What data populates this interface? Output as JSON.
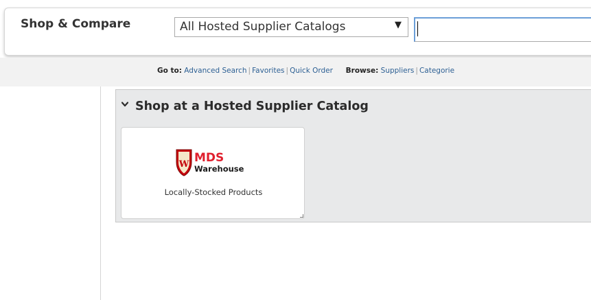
{
  "search_bar": {
    "title": "Shop & Compare",
    "catalog_select": {
      "selected": "All Hosted Supplier Catalogs",
      "caret_icon": "triangle-down-icon"
    },
    "search_input": {
      "value": "",
      "placeholder": ""
    }
  },
  "nav": {
    "goto_label": "Go to:",
    "goto_links": [
      "Advanced Search",
      "Favorites",
      "Quick Order"
    ],
    "browse_label": "Browse:",
    "browse_links": [
      "Suppliers",
      "Categorie"
    ],
    "link_color": "#2c5f93"
  },
  "hosted_section": {
    "header": "Shop at a Hosted Supplier Catalog",
    "header_icon": "chevron-down-icon",
    "panel_color": "#e8e9ea",
    "tiles": [
      {
        "logo_icon": "uw-crest-icon",
        "logo_title": "MDS",
        "logo_subtitle": "Warehouse",
        "logo_title_color": "#e0202e",
        "caption": "Locally-Stocked Products"
      }
    ]
  }
}
